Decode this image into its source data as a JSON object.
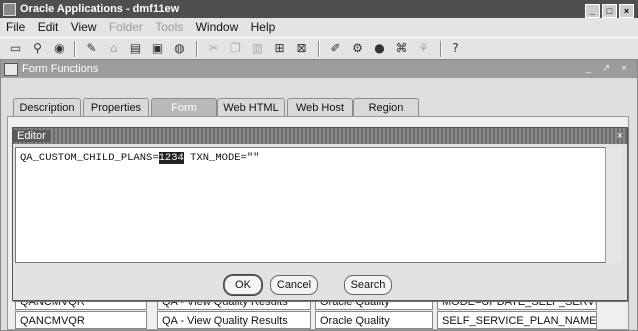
{
  "app": {
    "title": "Oracle Applications - dmf11ew",
    "controls": [
      "_",
      "□",
      "×"
    ]
  },
  "menu": [
    {
      "label": "File",
      "enabled": true
    },
    {
      "label": "Edit",
      "enabled": true
    },
    {
      "label": "View",
      "enabled": true
    },
    {
      "label": "Folder",
      "enabled": false
    },
    {
      "label": "Tools",
      "enabled": false
    },
    {
      "label": "Window",
      "enabled": true
    },
    {
      "label": "Help",
      "enabled": true
    }
  ],
  "toolbar": {
    "help_glyph": "?"
  },
  "window": {
    "title": "Form Functions",
    "controls": "_ ↗ ×"
  },
  "tabs": [
    {
      "label": "Description",
      "active": false
    },
    {
      "label": "Properties",
      "active": false
    },
    {
      "label": "Form",
      "active": true
    },
    {
      "label": "Web HTML",
      "active": false
    },
    {
      "label": "Web Host",
      "active": false
    },
    {
      "label": "Region",
      "active": false
    }
  ],
  "table": {
    "rows": [
      {
        "function": "QANCMVQR",
        "user_name": "QA - View Quality Results",
        "application": "Oracle Quality",
        "parameters": "MODE=UPDATE_SELF_SERVI"
      },
      {
        "function": "QANCMVQR",
        "user_name": "QA - View Quality Results",
        "application": "Oracle Quality",
        "parameters": "SELF_SERVICE_PLAN_NAME="
      }
    ]
  },
  "editor": {
    "title": "Editor",
    "close": "×",
    "text_before": "QA_CUSTOM_CHILD_PLANS=",
    "text_selected": "1234",
    "text_after": " TXN_MODE=\"\"",
    "ok_label": "OK",
    "cancel_label": "Cancel",
    "search_label": "Search"
  }
}
